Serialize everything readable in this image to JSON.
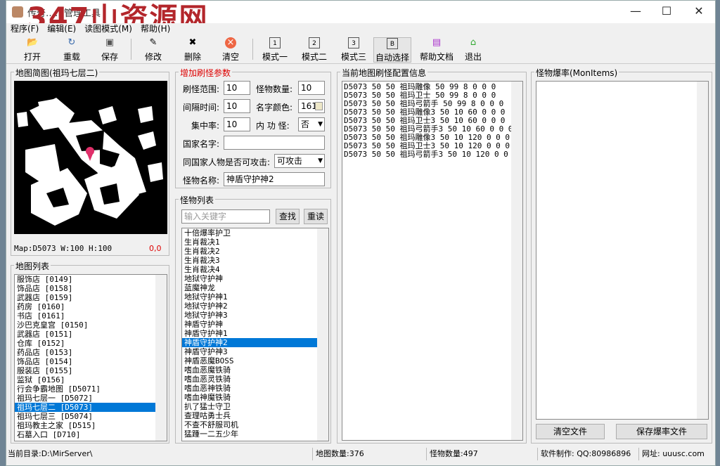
{
  "window": {
    "title": "传奇……管理工具",
    "watermark": "347山资源网"
  },
  "menu": [
    "程序(F)",
    "编辑(E)",
    "读图模式(M)",
    "帮助(H)"
  ],
  "toolbar": {
    "open": "打开",
    "refresh": "重载",
    "save": "保存",
    "modify": "修改",
    "delete": "删除",
    "clear": "清空",
    "mode1": "模式一",
    "mode2": "模式二",
    "mode3": "模式三",
    "auto_select": "自动选择",
    "help_doc": "帮助文档",
    "exit": "退出"
  },
  "map_preview": {
    "caption": "地图简图(祖玛七层二)",
    "info": "Map:D5073  W:100 H:100",
    "coords": "0,0"
  },
  "map_list": {
    "caption": "地图列表",
    "items": [
      "服饰店 [0149]",
      "饰品店 [0158]",
      "武器店 [0159]",
      "药房 [0160]",
      "书店 [0161]",
      "沙巴克皇宫 [0150]",
      "武器店 [0151]",
      "仓库 [0152]",
      "药品店 [0153]",
      "饰品店 [0154]",
      "服装店 [0155]",
      "监狱 [0156]",
      "行会争霸地图 [D5071]",
      "祖玛七层一 [D5072]",
      "祖玛七层二 [D5073]",
      "祖玛七层三 [D5074]",
      "祖玛教主之家 [D515]",
      "石墓入口 [D710]"
    ],
    "selected": 14
  },
  "params": {
    "caption": "增加刷怪参数",
    "range_label": "刷怪范围:",
    "range": "10",
    "count_label": "怪物数量:",
    "count": "10",
    "interval_label": "间隔时间:",
    "interval": "10",
    "color_label": "名字颜色:",
    "color": "161",
    "focus_label": "集中率:",
    "focus": "10",
    "inner_label": "内 功 怪:",
    "inner": "否",
    "nation_label": "国家名字:",
    "nation": "",
    "attack_label": "同国家人物是否可攻击:",
    "attack": "可攻击",
    "monster_label": "怪物名称:",
    "monster": "神盾守护神2"
  },
  "monster_list": {
    "caption": "怪物列表",
    "search_placeholder": "输入关键字",
    "find": "查找",
    "reload": "重读",
    "items": [
      "十倍爆率护卫",
      "生肖裁决1",
      "生肖裁决2",
      "生肖裁决3",
      "生肖裁决4",
      "地狱守护神",
      "蓝魔神龙",
      "地狱守护神1",
      "地狱守护神2",
      "地狱守护神3",
      "神盾守护神",
      "神盾守护神1",
      "神盾守护神2",
      "神盾守护神3",
      "神盾恶魔BOSS",
      "嗜血恶魔铁骑",
      "嗜血恶灵铁骑",
      "嗜血恶神铁骑",
      "嗜血神魔铁骑",
      "扒了猛士守卫",
      "查理咕勇士兵",
      "不查不舒服司机",
      "猛踵一二五少年"
    ],
    "selected": 12
  },
  "config": {
    "caption": "当前地图刷怪配置信息",
    "lines": [
      "D5073 50 50 祖玛雕像 50 99 8 0 0 0",
      "D5073 50 50 祖玛卫士 50 99 8 0 0 0",
      "D5073 50 50 祖玛弓箭手 50 99 8 0 0 0",
      "D5073 50 50 祖玛雕像3 50 10 60 0 0 0",
      "D5073 50 50 祖玛卫士3 50 10 60 0 0 0",
      "D5073 50 50 祖玛弓箭手3 50 10 60 0 0 0",
      "D5073 50 50 祖玛雕像3 50 10 120 0 0 0",
      "D5073 50 50 祖玛卫士3 50 10 120 0 0 0",
      "D5073 50 50 祖玛弓箭手3 50 10 120 0 0 0"
    ]
  },
  "drops": {
    "caption": "怪物爆率(MonItems)",
    "open_file": "清空文件",
    "save_file": "保存爆率文件"
  },
  "status": {
    "dir": "当前目录:D:\\MirServer\\",
    "maps": "地图数量:376",
    "monsters": "怪物数量:497",
    "author": "软件制作: QQ:80986896",
    "site": "网址: uuusc.com"
  }
}
